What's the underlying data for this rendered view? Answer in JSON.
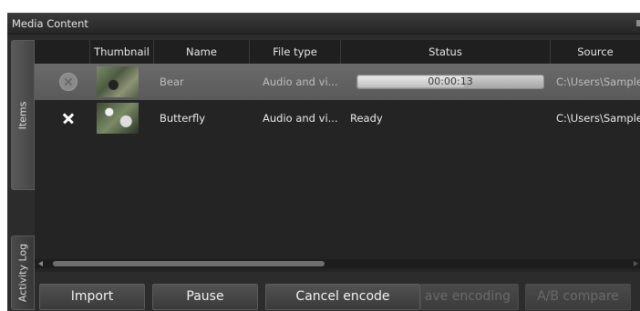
{
  "window": {
    "title": "Media Content"
  },
  "tabs": [
    {
      "label": "Items"
    },
    {
      "label": "Activity Log"
    }
  ],
  "table": {
    "columns": [
      "Thumbnail",
      "Name",
      "File type",
      "Status",
      "Source"
    ],
    "rows": [
      {
        "name": "Bear",
        "file_type": "Audio and vi...",
        "status": "00:00:13",
        "progress": 0.58,
        "source": "C:\\Users\\Sample.",
        "thumbnail": "bear-thumbnail"
      },
      {
        "name": "Butterfly",
        "file_type": "Audio and vi...",
        "status": "Ready",
        "source": "C:\\Users\\Sample.",
        "thumbnail": "butterfly-thumbnail"
      }
    ]
  },
  "toolbar": {
    "import_label": "Import",
    "pause_label": "Pause",
    "cancel_label": "Cancel encode",
    "save_label": "ave encoding",
    "ab_label": "A/B compare"
  },
  "colors": {
    "background": "#2c2c2c",
    "selected_row": "#5f5f5f",
    "text": "#eaeaea"
  }
}
